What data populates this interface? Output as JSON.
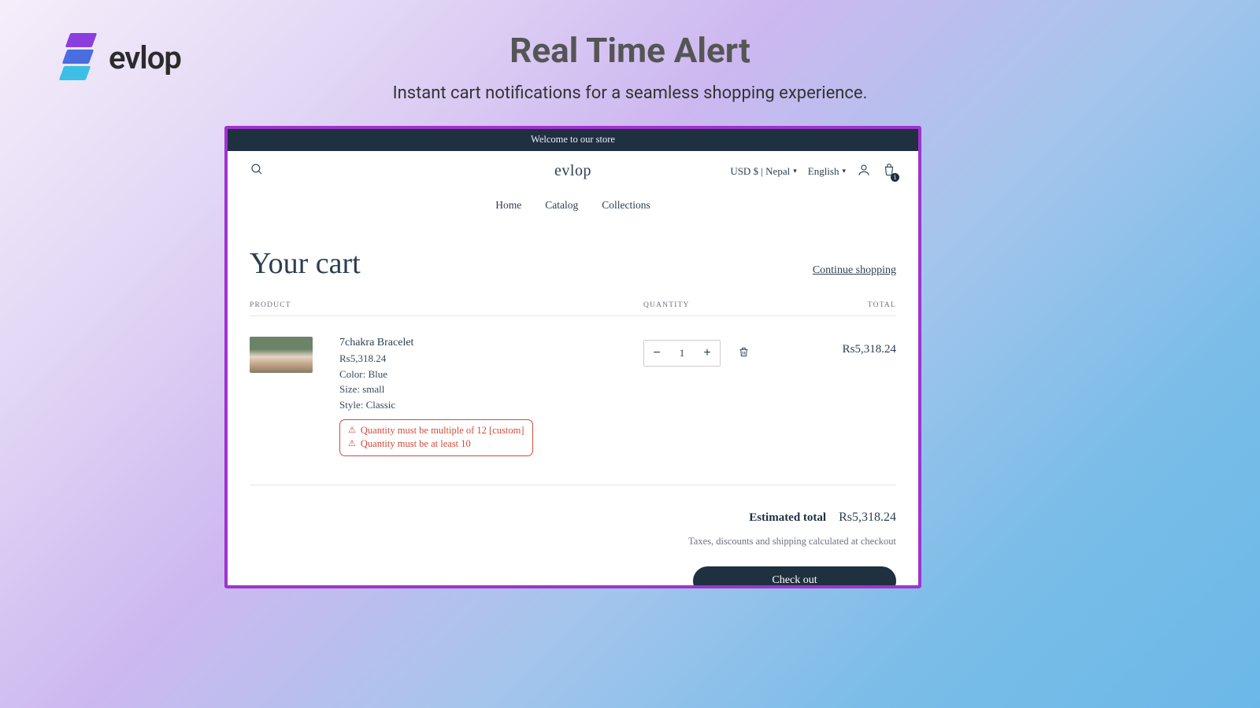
{
  "brand": {
    "name": "evlop"
  },
  "hero": {
    "title": "Real Time Alert",
    "subtitle": "Instant cart notifications for a seamless shopping experience."
  },
  "store": {
    "announce": "Welcome to our store",
    "logo": "evlop",
    "currency_selector": "USD $ | Nepal",
    "lang_selector": "English",
    "cart_count": "1",
    "nav": {
      "home": "Home",
      "catalog": "Catalog",
      "collections": "Collections"
    }
  },
  "cart": {
    "title": "Your cart",
    "continue": "Continue shopping",
    "columns": {
      "product": "PRODUCT",
      "quantity": "QUANTITY",
      "total": "TOTAL"
    },
    "item": {
      "name": "7chakra Bracelet",
      "price": "Rs5,318.24",
      "attr_color": "Color: Blue",
      "attr_size": "Size: small",
      "attr_style": "Style: Classic",
      "alerts": {
        "a": "Quantity must be multiple of 12 [custom]",
        "b": "Quantity must be at least 10"
      },
      "qty": "1",
      "line_total": "Rs5,318.24"
    },
    "summary": {
      "est_label": "Estimated total",
      "est_value": "Rs5,318.24",
      "tax_note": "Taxes, discounts and shipping calculated at checkout",
      "checkout": "Check out"
    }
  }
}
